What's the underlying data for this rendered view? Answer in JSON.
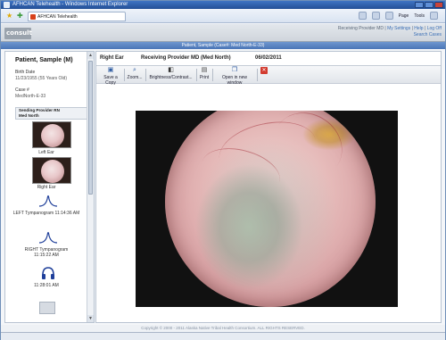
{
  "window": {
    "title": "AFHCAN Telehealth - Windows Internet Explorer"
  },
  "browser": {
    "tab_label": "AFHCAN Telehealth",
    "tools": {
      "page": "Page",
      "tools": "Tools"
    }
  },
  "app": {
    "logo": "consult",
    "header": {
      "user": "Receiving Provider MD",
      "my_settings": "My Settings",
      "help": "Help",
      "logout": "Log Off",
      "search_cases": "Search Cases"
    },
    "case_title": "Patient, Sample (Case#: Med North-E-33)"
  },
  "patient": {
    "name": "Patient, Sample (M)",
    "birth_date_label": "Birth Date",
    "birth_date_value": "11/23/1955 (55 Years Old)",
    "case_label": "Case #",
    "case_value": "MedNorth-E-33"
  },
  "sidebar": {
    "sending_provider_header": "Sending Provider RN",
    "sending_provider_value": "Med North",
    "items": [
      {
        "label": "Left Ear"
      },
      {
        "label": "Right Ear"
      },
      {
        "label": "LEFT Tympanogram 11:14:36 AM"
      },
      {
        "label": "RIGHT Tympanogram 11:15:22 AM"
      },
      {
        "label": "11:28:01 AM"
      }
    ]
  },
  "content": {
    "ear": "Right Ear",
    "provider": "Receiving Provider MD (Med North)",
    "date": "06/02/2011"
  },
  "toolbar": {
    "save": "Save a Copy",
    "zoom": "Zoom...",
    "brightness": "Brightness/Contrast...",
    "print": "Print",
    "open_new": "Open in new window"
  },
  "footer": {
    "copyright": "Copyright © 2000 - 2011 Alaska Native Tribal Health Consortium. ALL RIGHTS RESERVED."
  },
  "colors": {
    "titlebar": "#2b5aa6",
    "case_header": "#5a84c2",
    "close_button": "#c9433a"
  }
}
